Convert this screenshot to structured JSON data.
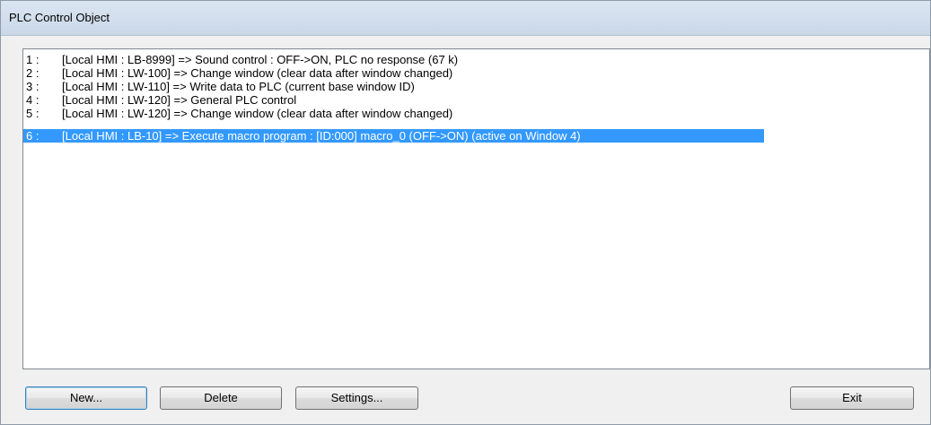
{
  "window": {
    "title": "PLC Control Object"
  },
  "list": {
    "items": [
      {
        "num": "1 :",
        "text": "[Local HMI : LB-8999] => Sound control : OFF->ON, PLC no response (67 k)",
        "selected": false
      },
      {
        "num": "2 :",
        "text": "[Local HMI : LW-100] => Change window (clear data after window changed)",
        "selected": false
      },
      {
        "num": "3 :",
        "text": "[Local HMI : LW-110] => Write data to PLC (current base window ID)",
        "selected": false
      },
      {
        "num": "4 :",
        "text": "[Local HMI : LW-120] => General PLC control",
        "selected": false
      },
      {
        "num": "5 :",
        "text": "[Local HMI : LW-120] => Change window (clear data after window changed)",
        "selected": false
      },
      {
        "num": "6 :",
        "text": "[Local HMI : LB-10] => Execute macro program : [ID:000] macro_0 (OFF->ON)  (active on Window 4)",
        "selected": true
      }
    ],
    "selection_color": "#3399ff"
  },
  "buttons": {
    "new_label": "New...",
    "delete_label": "Delete",
    "settings_label": "Settings...",
    "exit_label": "Exit"
  }
}
